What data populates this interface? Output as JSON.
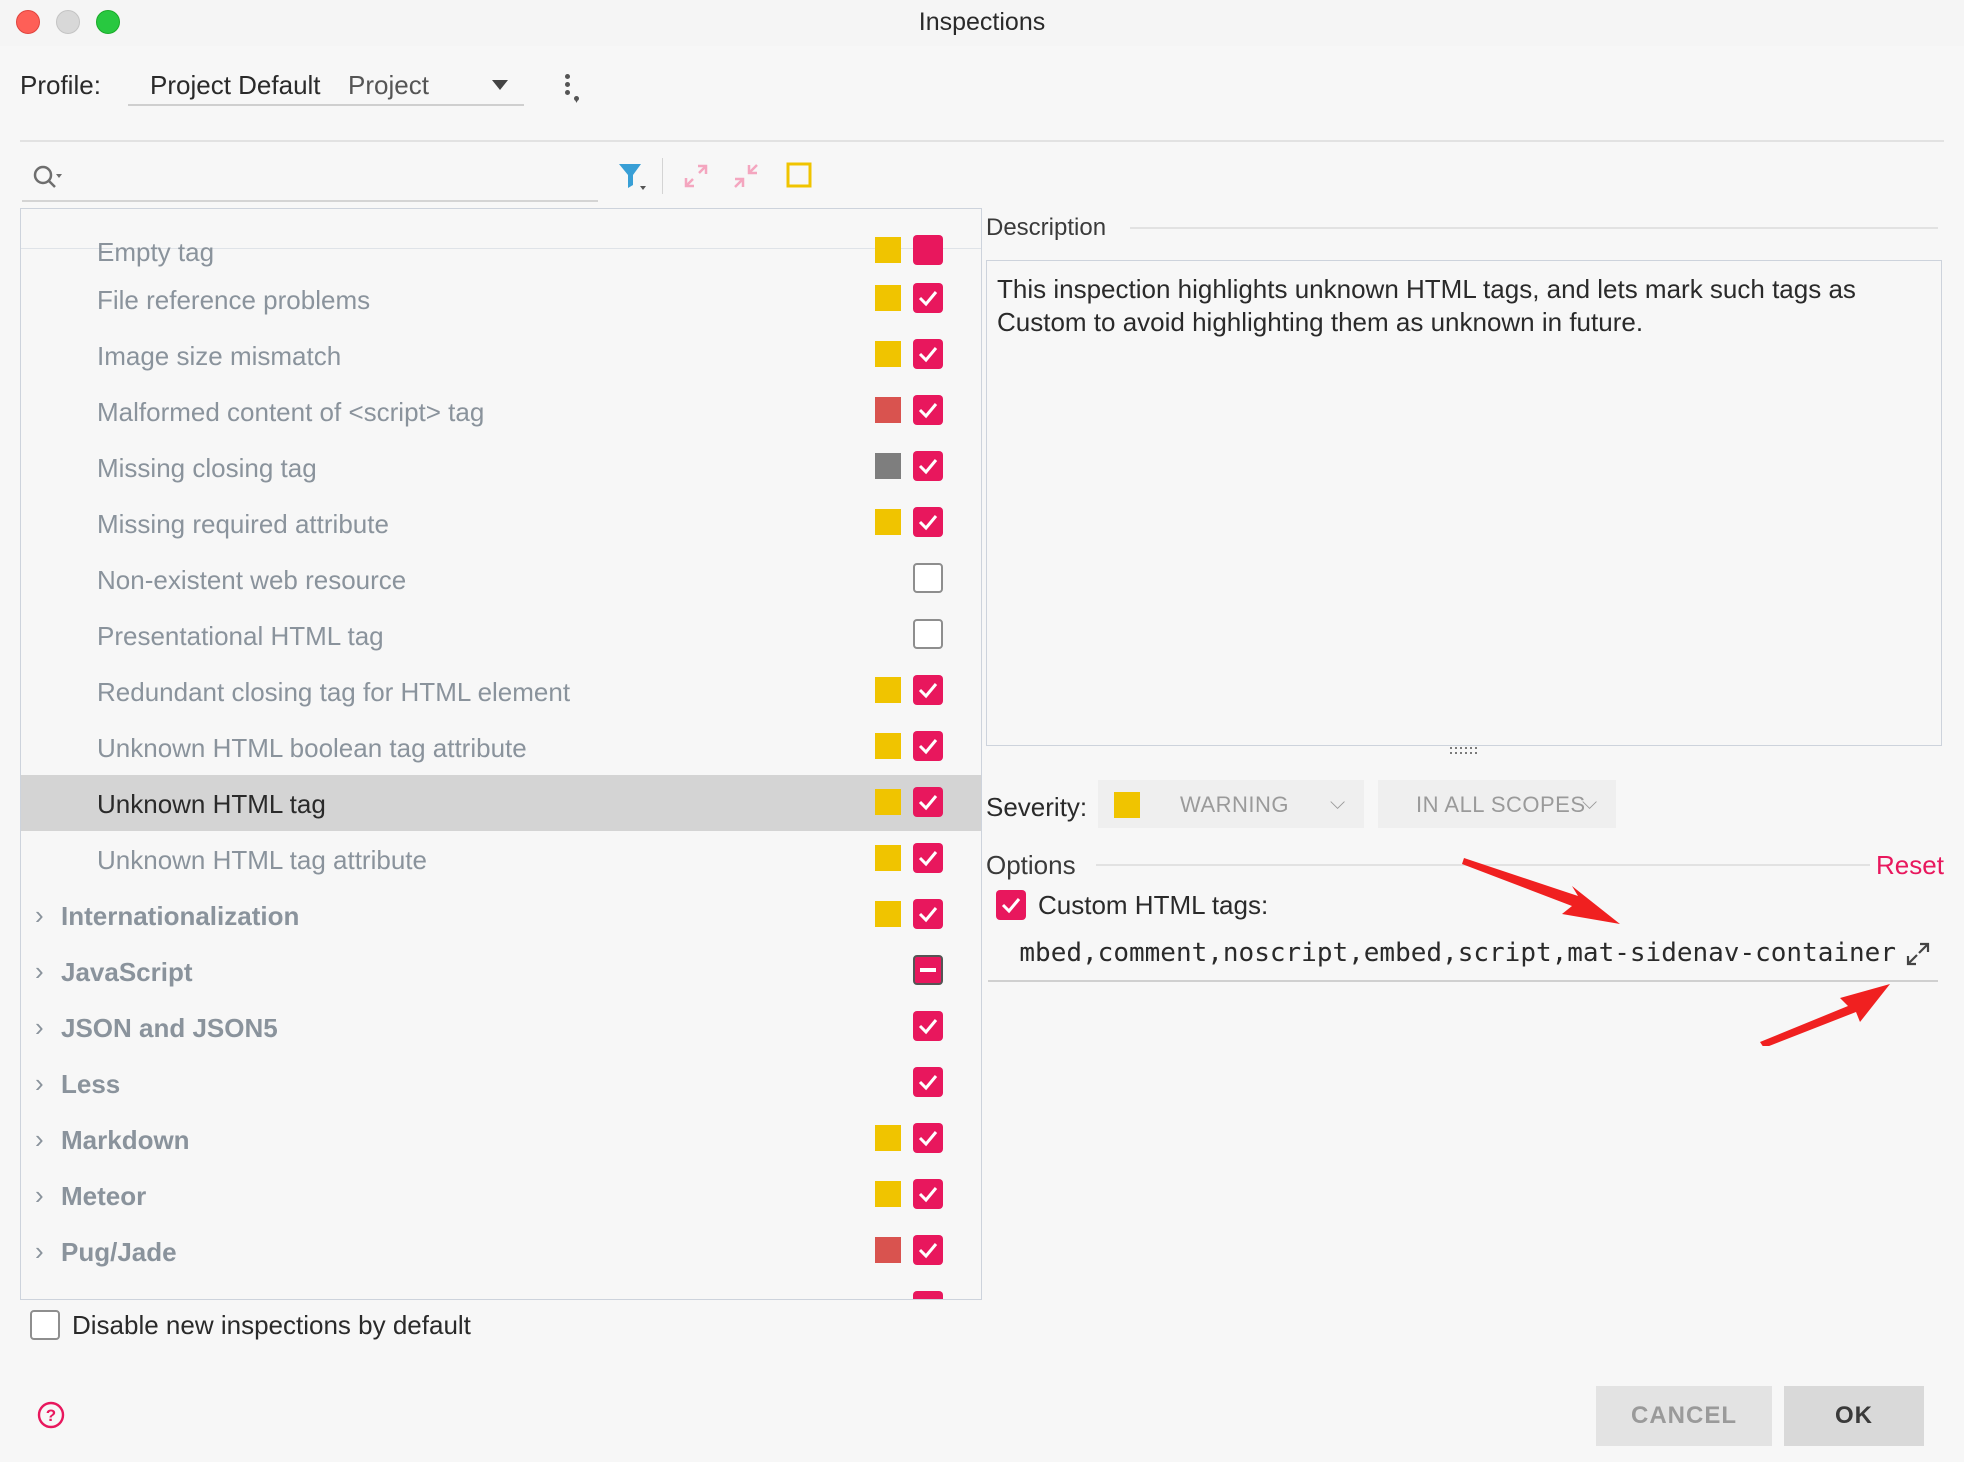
{
  "window": {
    "title": "Inspections"
  },
  "profile": {
    "label": "Profile:",
    "name": "Project Default",
    "scope": "Project"
  },
  "search": {
    "placeholder": ""
  },
  "tree": {
    "partial_top": "Empty tag",
    "items": [
      {
        "label": "File reference problems",
        "severity_color": "#f0c400",
        "checkbox": "on",
        "group": false,
        "selected": false
      },
      {
        "label": "Image size mismatch",
        "severity_color": "#f0c400",
        "checkbox": "on",
        "group": false,
        "selected": false
      },
      {
        "label": "Malformed content of <script> tag",
        "severity_color": "#d9534f",
        "checkbox": "on",
        "group": false,
        "selected": false
      },
      {
        "label": "Missing closing tag",
        "severity_color": "#7e7e7e",
        "checkbox": "on",
        "group": false,
        "selected": false
      },
      {
        "label": "Missing required attribute",
        "severity_color": "#f0c400",
        "checkbox": "on",
        "group": false,
        "selected": false
      },
      {
        "label": "Non-existent web resource",
        "severity_color": "",
        "checkbox": "off",
        "group": false,
        "selected": false
      },
      {
        "label": "Presentational HTML tag",
        "severity_color": "",
        "checkbox": "off",
        "group": false,
        "selected": false
      },
      {
        "label": "Redundant closing tag for HTML element",
        "severity_color": "#f0c400",
        "checkbox": "on",
        "group": false,
        "selected": false
      },
      {
        "label": "Unknown HTML boolean tag attribute",
        "severity_color": "#f0c400",
        "checkbox": "on",
        "group": false,
        "selected": false
      },
      {
        "label": "Unknown HTML tag",
        "severity_color": "#f0c400",
        "checkbox": "on",
        "group": false,
        "selected": true
      },
      {
        "label": "Unknown HTML tag attribute",
        "severity_color": "#f0c400",
        "checkbox": "on",
        "group": false,
        "selected": false
      },
      {
        "label": "Internationalization",
        "severity_color": "#f0c400",
        "checkbox": "on",
        "group": true,
        "selected": false
      },
      {
        "label": "JavaScript",
        "severity_color": "",
        "checkbox": "mixed",
        "group": true,
        "selected": false
      },
      {
        "label": "JSON and JSON5",
        "severity_color": "",
        "checkbox": "on",
        "group": true,
        "selected": false
      },
      {
        "label": "Less",
        "severity_color": "",
        "checkbox": "on",
        "group": true,
        "selected": false
      },
      {
        "label": "Markdown",
        "severity_color": "#f0c400",
        "checkbox": "on",
        "group": true,
        "selected": false
      },
      {
        "label": "Meteor",
        "severity_color": "#f0c400",
        "checkbox": "on",
        "group": true,
        "selected": false
      },
      {
        "label": "Pug/Jade",
        "severity_color": "#d9534f",
        "checkbox": "on",
        "group": true,
        "selected": false
      }
    ]
  },
  "description": {
    "label": "Description",
    "text": "This inspection highlights unknown HTML tags, and lets mark such tags as Custom to avoid highlighting them as unknown in future."
  },
  "severity": {
    "label": "Severity:",
    "value": "WARNING",
    "color": "#f0c400",
    "scope": "IN ALL SCOPES"
  },
  "options": {
    "label": "Options",
    "reset": "Reset",
    "custom_tags_label": "Custom HTML tags:",
    "custom_tags_value": "mbed,comment,noscript,embed,script,mat-sidenav-container"
  },
  "footer": {
    "disable_label": "Disable new inspections by default",
    "cancel": "CANCEL",
    "ok": "OK"
  },
  "colors": {
    "accent": "#e8175d",
    "annotation_arrow": "#f02020"
  }
}
